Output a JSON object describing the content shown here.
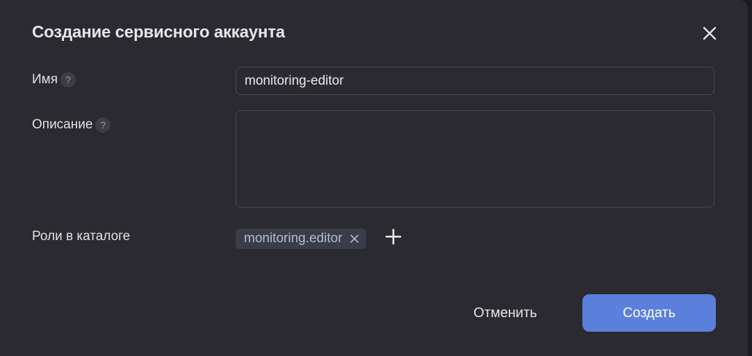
{
  "dialog": {
    "title": "Создание сервисного аккаунта",
    "close_icon": "close-icon"
  },
  "form": {
    "name": {
      "label": "Имя",
      "help": "?",
      "value": "monitoring-editor"
    },
    "description": {
      "label": "Описание",
      "help": "?",
      "value": ""
    },
    "roles": {
      "label": "Роли в каталоге",
      "items": [
        {
          "label": "monitoring.editor"
        }
      ],
      "add_icon": "plus-icon"
    }
  },
  "actions": {
    "cancel_label": "Отменить",
    "create_label": "Создать"
  },
  "colors": {
    "background": "#2a2a30",
    "accent": "#5b80dc",
    "chip": "#3a3d47"
  }
}
